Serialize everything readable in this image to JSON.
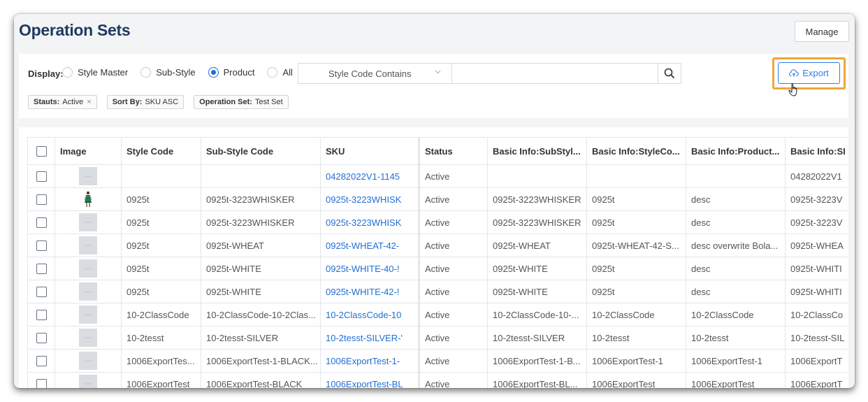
{
  "page": {
    "title": "Operation Sets"
  },
  "header": {
    "manage_label": "Manage"
  },
  "filters": {
    "display_label": "Display:",
    "options": [
      {
        "label": "Style Master",
        "selected": false
      },
      {
        "label": "Sub-Style",
        "selected": false
      },
      {
        "label": "Product",
        "selected": true
      },
      {
        "label": "All",
        "selected": false
      }
    ],
    "search_field": "Style Code Contains",
    "search_value": "",
    "export_label": "Export",
    "tags": [
      {
        "key": "Stauts:",
        "value": "Active",
        "removable": true
      },
      {
        "key": "Sort By:",
        "value": "SKU ASC",
        "removable": false
      },
      {
        "key": "Operation Set:",
        "value": "Test Set",
        "removable": false
      }
    ]
  },
  "colors": {
    "accent": "#1f6fd6",
    "title": "#1f3a5f",
    "highlight": "#f0a53a"
  },
  "table": {
    "columns": [
      "Image",
      "Style Code",
      "Sub-Style Code",
      "SKU",
      "Status",
      "Basic Info:SubStyl...",
      "Basic Info:StyleCo...",
      "Basic Info:Product...",
      "Basic Info:SI"
    ],
    "rows": [
      {
        "image": "placeholder",
        "style": "",
        "substyle": "",
        "sku": "04282022V1-1145",
        "status": "Active",
        "b1": "",
        "b2": "",
        "b3": "",
        "b4": "04282022V1"
      },
      {
        "image": "photo",
        "style": "0925t",
        "substyle": "0925t-3223WHISKER",
        "sku": "0925t-3223WHISK",
        "status": "Active",
        "b1": "0925t-3223WHISKER",
        "b2": "0925t",
        "b3": "desc",
        "b4": "0925t-3223V"
      },
      {
        "image": "placeholder",
        "style": "0925t",
        "substyle": "0925t-3223WHISKER",
        "sku": "0925t-3223WHISK",
        "status": "Active",
        "b1": "0925t-3223WHISKER",
        "b2": "0925t",
        "b3": "desc",
        "b4": "0925t-3223V"
      },
      {
        "image": "placeholder",
        "style": "0925t",
        "substyle": "0925t-WHEAT",
        "sku": "0925t-WHEAT-42-",
        "status": "Active",
        "b1": "0925t-WHEAT",
        "b2": "0925t-WHEAT-42-S...",
        "b3": "desc overwrite Bola...",
        "b4": "0925t-WHEA"
      },
      {
        "image": "placeholder",
        "style": "0925t",
        "substyle": "0925t-WHITE",
        "sku": "0925t-WHITE-40-!",
        "status": "Active",
        "b1": "0925t-WHITE",
        "b2": "0925t",
        "b3": "desc",
        "b4": "0925t-WHITI"
      },
      {
        "image": "placeholder",
        "style": "0925t",
        "substyle": "0925t-WHITE",
        "sku": "0925t-WHITE-42-!",
        "status": "Active",
        "b1": "0925t-WHITE",
        "b2": "0925t",
        "b3": "desc",
        "b4": "0925t-WHITI"
      },
      {
        "image": "placeholder",
        "style": "10-2ClassCode",
        "substyle": "10-2ClassCode-10-2Clas...",
        "sku": "10-2ClassCode-10",
        "status": "Active",
        "b1": "10-2ClassCode-10-...",
        "b2": "10-2ClassCode",
        "b3": "10-2ClassCode",
        "b4": "10-2ClassCo"
      },
      {
        "image": "placeholder",
        "style": "10-2tesst",
        "substyle": "10-2tesst-SILVER",
        "sku": "10-2tesst-SILVER-'",
        "status": "Active",
        "b1": "10-2tesst-SILVER",
        "b2": "10-2tesst",
        "b3": "10-2tesst",
        "b4": "10-2tesst-SIL"
      },
      {
        "image": "placeholder",
        "style": "1006ExportTes...",
        "substyle": "1006ExportTest-1-BLACK...",
        "sku": "1006ExportTest-1-",
        "status": "Active",
        "b1": "1006ExportTest-1-B...",
        "b2": "1006ExportTest-1",
        "b3": "1006ExportTest-1",
        "b4": "1006ExportT"
      },
      {
        "image": "placeholder",
        "style": "1006ExportTest",
        "substyle": "1006ExportTest-BLACK",
        "sku": "1006ExportTest-BL",
        "status": "Active",
        "b1": "1006ExportTest-BL...",
        "b2": "1006ExportTest",
        "b3": "1006ExportTest",
        "b4": "1006ExportT"
      }
    ]
  }
}
